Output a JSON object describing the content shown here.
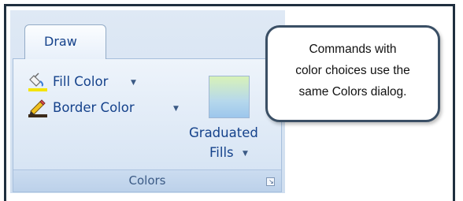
{
  "ribbon": {
    "tab_label": "Draw",
    "commands": {
      "fill_color": {
        "label": "Fill Color",
        "icon": "paint-bucket-icon",
        "swatch_color": "#f4e400"
      },
      "border_color": {
        "label": "Border Color",
        "icon": "pencil-icon",
        "swatch_color": "#3a2a1a"
      },
      "graduated_fills": {
        "label_line1": "Graduated",
        "label_line2": "Fills"
      }
    },
    "group_label": "Colors"
  },
  "callout": {
    "line1": "Commands with",
    "line2": "color choices use the",
    "line3": "same Colors dialog."
  },
  "colors": {
    "frame": "#1f2f3f",
    "ribbon_text": "#15428b",
    "callout_border": "#3a4f65"
  }
}
